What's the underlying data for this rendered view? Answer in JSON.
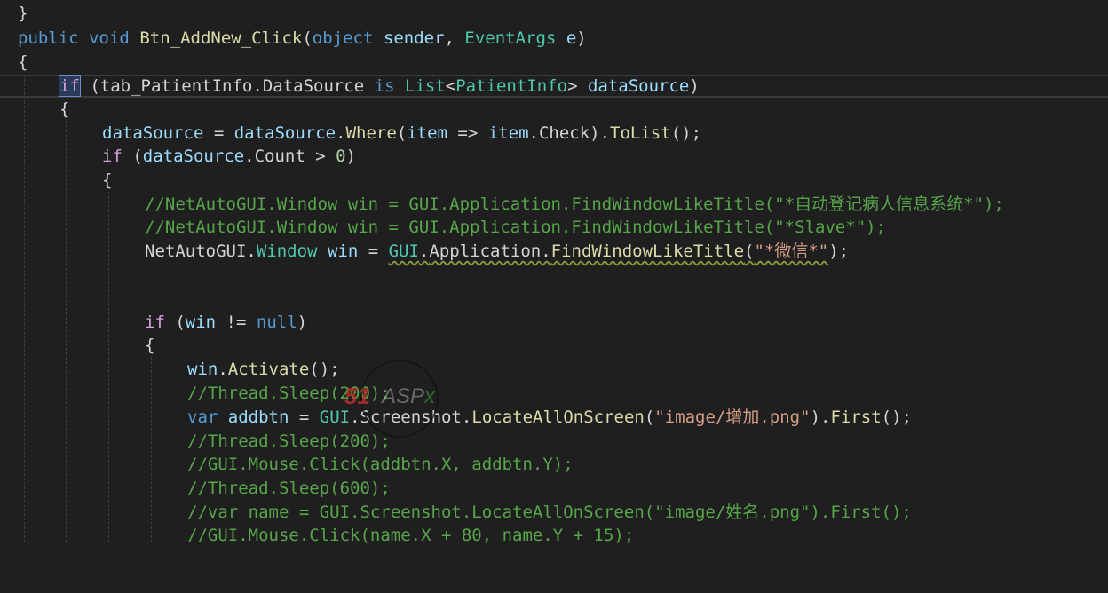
{
  "code": {
    "l1": "}",
    "l2": {
      "kw1": "public",
      "kw2": "void",
      "method": "Btn_AddNew_Click",
      "p1": "(",
      "kw3": "object",
      "arg1": "sender",
      "comma": ", ",
      "type": "EventArgs",
      "arg2": "e",
      "p2": ")"
    },
    "l3": "{",
    "l4": {
      "kw": "if",
      "a": " (",
      "obj": "tab_PatientInfo",
      "dot": ".",
      "prop": "DataSource",
      "isk": "is",
      "list": "List",
      "lt": "<",
      "cls": "PatientInfo",
      "gt": ">",
      "var": "dataSource",
      "end": ")"
    },
    "l5": "{",
    "l6": {
      "v1": "dataSource",
      "eq": " = ",
      "v2": "dataSource",
      "dot1": ".",
      "m1": "Where",
      "p1": "(",
      "v3": "item",
      "arrow": " => ",
      "v4": "item",
      "dot2": ".Check",
      "p2": ").",
      "m2": "ToList",
      "end": "();"
    },
    "l7": {
      "kw": "if",
      "a": " (",
      "v": "dataSource",
      "prop": ".Count",
      "op": " > ",
      "num": "0",
      "end": ")"
    },
    "l8": "{",
    "l9": "//NetAutoGUI.Window win = GUI.Application.FindWindowLikeTitle(\"*自动登记病人信息系统*\");",
    "l10": "//NetAutoGUI.Window win = GUI.Application.FindWindowLikeTitle(\"*Slave*\");",
    "l11": {
      "ns": "NetAutoGUI",
      "dot1": ".",
      "type": "Window",
      "var": "win",
      "eq": " = ",
      "gui": "GUI",
      "dot2": ".",
      "app": "Application",
      "dot3": ".",
      "m": "FindWindowLikeTitle",
      "p1": "(",
      "str": "\"*微信*\"",
      "end": ");"
    },
    "l14": {
      "kw": "if",
      "a": " (",
      "v": "win",
      "op": " != ",
      "nul": "null",
      "end": ")"
    },
    "l15": "{",
    "l16": {
      "v": "win",
      "dot": ".",
      "m": "Activate",
      "end": "();"
    },
    "l17": "//Thread.Sleep(200);",
    "l18": {
      "kw": "var",
      "v": "addbtn",
      "eq": " = ",
      "gui": "GUI",
      "dot1": ".",
      "cls": "Screenshot",
      "dot2": ".",
      "m1": "LocateAllOnScreen",
      "p1": "(",
      "str": "\"image/增加.png\"",
      "p2": ").",
      "m2": "First",
      "end": "();"
    },
    "l19": "//Thread.Sleep(200);",
    "l20": "//GUI.Mouse.Click(addbtn.X, addbtn.Y);",
    "l21": "//Thread.Sleep(600);",
    "l22": "//var name = GUI.Screenshot.LocateAllOnScreen(\"image/姓名.png\").First();",
    "l23": "//GUI.Mouse.Click(name.X + 80, name.Y + 15);"
  },
  "watermark": {
    "brand_red": "51",
    "brand_gray": "ASP",
    "brand_green": "x"
  },
  "colors": {
    "background": "#1f1f1f",
    "keyword": "#569cd6",
    "control": "#d8a0df",
    "type": "#4ec9b0",
    "method": "#dcdcaa",
    "variable": "#9cdcfe",
    "string": "#d69d85",
    "comment": "#57a64a"
  }
}
